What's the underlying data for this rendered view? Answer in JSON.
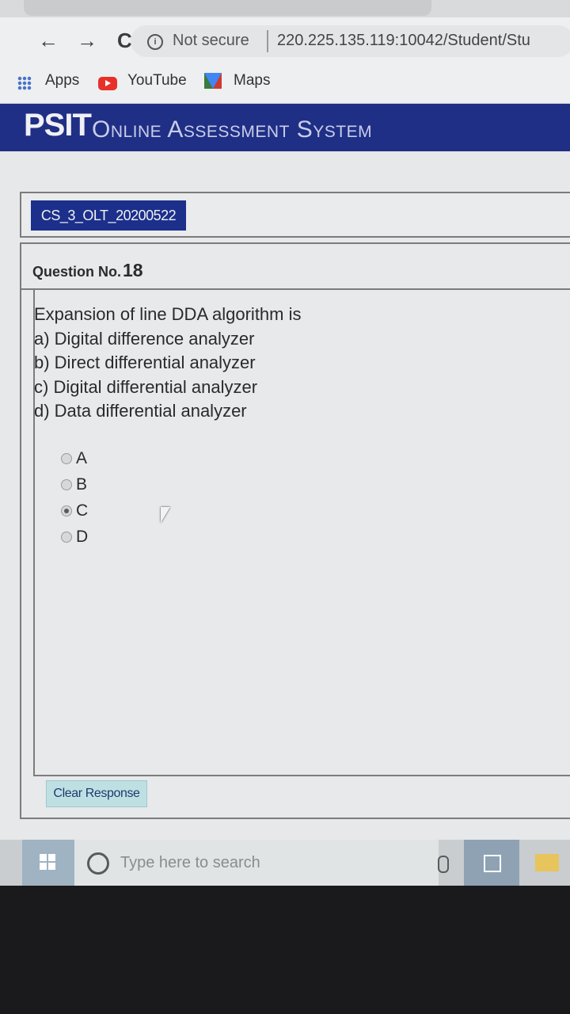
{
  "browser": {
    "nav": {
      "back": "←",
      "forward": "→",
      "reload": "C"
    },
    "security_label": "Not secure",
    "url": "220.225.135.119:10042/Student/Stu",
    "bookmarks": [
      {
        "label": "Apps",
        "icon": "apps-grid-icon"
      },
      {
        "label": "YouTube",
        "icon": "youtube-icon"
      },
      {
        "label": "Maps",
        "icon": "maps-icon"
      }
    ]
  },
  "header": {
    "brand": "PSIT",
    "subtitle": "Online Assessment System"
  },
  "test": {
    "code": "CS_3_OLT_20200522"
  },
  "question": {
    "label": "Question No.",
    "number": "18",
    "lines": [
      "Expansion of line DDA algorithm is",
      "a) Digital difference analyzer",
      "b) Direct differential analyzer",
      "c) Digital differential analyzer",
      "d) Data differential analyzer"
    ],
    "options": [
      {
        "label": "A",
        "selected": false
      },
      {
        "label": "B",
        "selected": false
      },
      {
        "label": "C",
        "selected": true
      },
      {
        "label": "D",
        "selected": false
      }
    ],
    "clear_label": "Clear Response"
  },
  "taskbar": {
    "search_placeholder": "Type here to search"
  },
  "colors": {
    "banner": "#1f2f86",
    "test_code_bg": "#1b2f8b",
    "clear_btn_bg": "#bfe0e3"
  }
}
